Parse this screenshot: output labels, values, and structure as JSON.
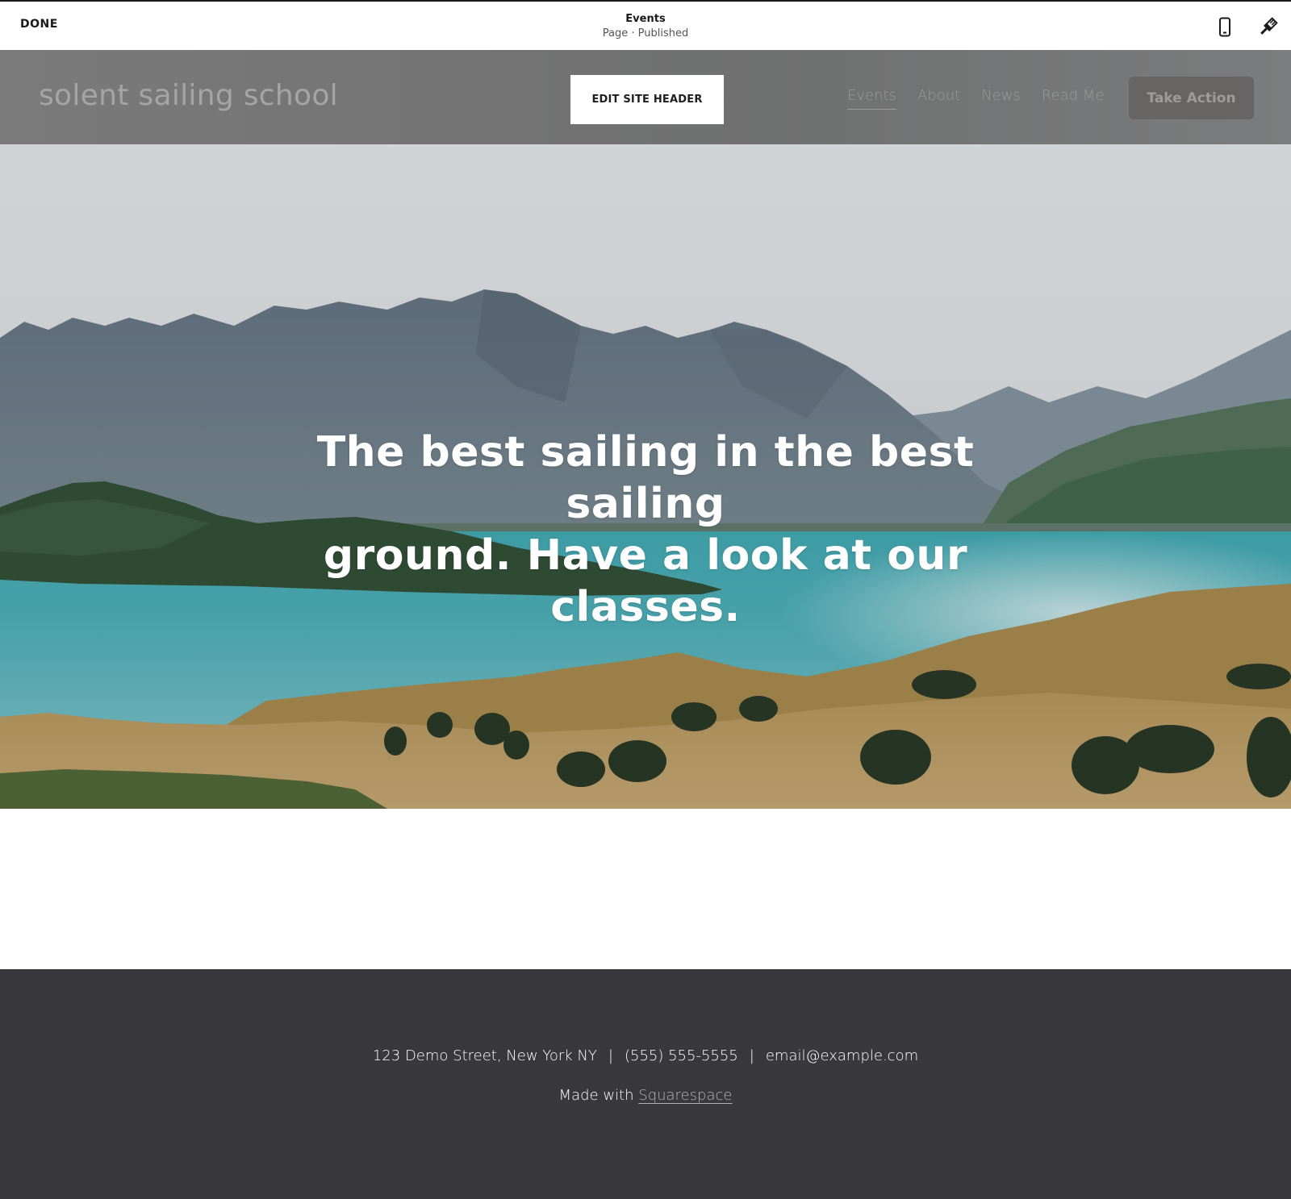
{
  "editor_bar": {
    "done_label": "DONE",
    "page_title": "Events",
    "page_status": "Page · Published",
    "icons": {
      "mobile_preview": "mobile-phone-icon",
      "site_styles": "paintbrush-icon"
    }
  },
  "site_header": {
    "logo_text": "solent sailing school",
    "edit_button_label": "EDIT SITE HEADER",
    "nav": [
      {
        "label": "Events",
        "active": true
      },
      {
        "label": "About",
        "active": false
      },
      {
        "label": "News",
        "active": false
      },
      {
        "label": "Read Me",
        "active": false
      }
    ],
    "cta_label": "Take Action"
  },
  "hero": {
    "headline_line1": "The best sailing in the best sailing",
    "headline_line2": "ground. Have a look at our classes.",
    "image_description": "mountain-lake-landscape"
  },
  "footer": {
    "address": "123 Demo Street, New York NY",
    "separator": "|",
    "phone": "(555) 555-5555",
    "email": "email@example.com",
    "made_with_prefix": "Made with",
    "made_with_link": "Squarespace"
  },
  "colors": {
    "footer_bg": "#39383d",
    "header_overlay": "#757575",
    "cta_bg": "#666564",
    "lake": "#3e9ba3"
  }
}
